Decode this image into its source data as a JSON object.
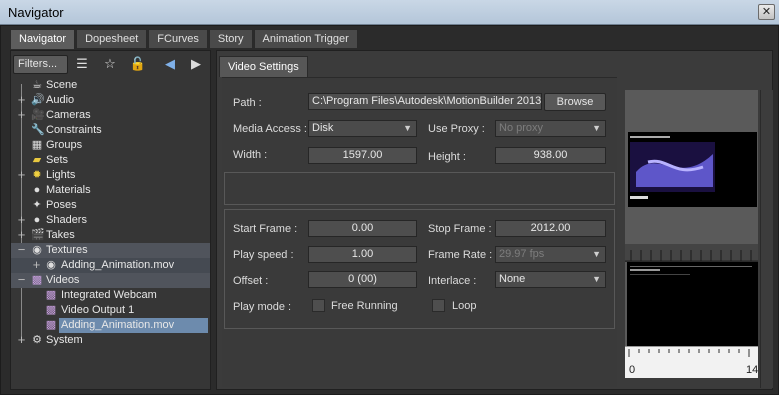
{
  "window": {
    "title": "Navigator"
  },
  "tabs": [
    "Navigator",
    "Dopesheet",
    "FCurves",
    "Story",
    "Animation Trigger"
  ],
  "toolbar": {
    "filters_label": "Filters..."
  },
  "tree": {
    "scene": "Scene",
    "audio": "Audio",
    "cameras": "Cameras",
    "constraints": "Constraints",
    "groups": "Groups",
    "sets": "Sets",
    "lights": "Lights",
    "materials": "Materials",
    "poses": "Poses",
    "shaders": "Shaders",
    "takes": "Takes",
    "textures": "Textures",
    "texture_child": "Adding_Animation.mov",
    "videos": "Videos",
    "video_webcam": "Integrated Webcam",
    "video_output": "Video Output 1",
    "video_anim": "Adding_Animation.mov",
    "system": "System"
  },
  "video_settings": {
    "tab_label": "Video Settings",
    "path_label": "Path :",
    "path_value": "C:\\Program Files\\Autodesk\\MotionBuilder 2013\\",
    "browse_label": "Browse",
    "media_access_label": "Media Access :",
    "media_access_value": "Disk",
    "use_proxy_label": "Use Proxy :",
    "use_proxy_value": "No proxy",
    "width_label": "Width :",
    "width_value": "1597.00",
    "height_label": "Height :",
    "height_value": "938.00",
    "start_frame_label": "Start Frame :",
    "start_frame_value": "0.00",
    "stop_frame_label": "Stop Frame :",
    "stop_frame_value": "2012.00",
    "play_speed_label": "Play speed :",
    "play_speed_value": "1.00",
    "frame_rate_label": "Frame Rate :",
    "frame_rate_value": "29.97 fps",
    "offset_label": "Offset :",
    "offset_value": "0 (00)",
    "interlace_label": "Interlace :",
    "interlace_value": "None",
    "play_mode_label": "Play mode :",
    "free_running_label": "Free Running",
    "loop_label": "Loop"
  },
  "timeline": {
    "start": "0",
    "end": "14"
  },
  "colors": {
    "selection": "#6d8bad",
    "titlebar": "#c9d7e6"
  }
}
